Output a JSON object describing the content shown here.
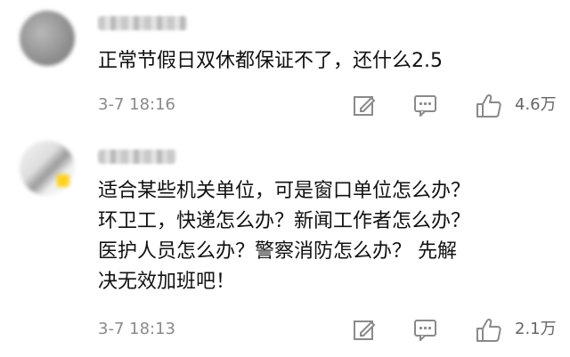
{
  "comments": [
    {
      "text": "正常节假日双休都保证不了，还什么2.5",
      "time": "3-7 18:16",
      "likes": "4.6万"
    },
    {
      "text": "适合某些机关单位，可是窗口单位怎么办？\n环卫工，快递怎么办？新闻工作者怎么办？\n医护人员怎么办？警察消防怎么办？ 先解\n决无效加班吧！",
      "time": "3-7 18:13",
      "likes": "2.1万"
    }
  ],
  "icons": [
    "edit-icon",
    "comment-icon",
    "like-icon"
  ],
  "colors": {
    "text": "#111111",
    "meta": "#8a8a8a",
    "icon": "#8a8a8a"
  }
}
